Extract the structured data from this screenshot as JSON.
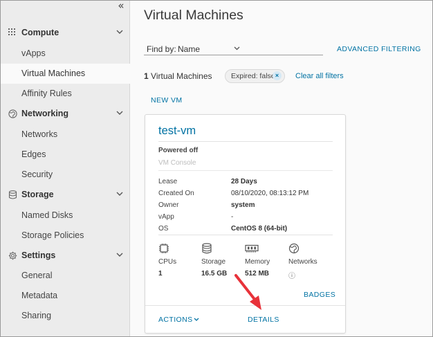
{
  "sidebar": {
    "collapse_glyph": "«",
    "groups": [
      {
        "label": "Compute",
        "icon": "grid-icon",
        "items": [
          "vApps",
          "Virtual Machines",
          "Affinity Rules"
        ]
      },
      {
        "label": "Networking",
        "icon": "globe-icon",
        "items": [
          "Networks",
          "Edges",
          "Security"
        ]
      },
      {
        "label": "Storage",
        "icon": "database-icon",
        "items": [
          "Named Disks",
          "Storage Policies"
        ]
      },
      {
        "label": "Settings",
        "icon": "gear-icon",
        "items": [
          "General",
          "Metadata",
          "Sharing"
        ]
      }
    ],
    "active_item": "Virtual Machines"
  },
  "main": {
    "title": "Virtual Machines",
    "find_by": {
      "label": "Find by:",
      "value": "Name"
    },
    "advanced_filtering": "ADVANCED FILTERING",
    "vm_count_number": "1",
    "vm_count_text": "Virtual Machines",
    "filter_chip": "Expired: false",
    "filter_chip_close": "×",
    "clear_all": "Clear all filters",
    "new_vm": "NEW VM"
  },
  "card": {
    "name": "test-vm",
    "power_state": "Powered off",
    "console": "VM Console",
    "properties": [
      {
        "key": "Lease",
        "value": "28 Days"
      },
      {
        "key": "Created On",
        "value": "08/10/2020, 08:13:12 PM"
      },
      {
        "key": "Owner",
        "value": "system"
      },
      {
        "key": "vApp",
        "value": "-"
      },
      {
        "key": "OS",
        "value": "CentOS 8 (64-bit)"
      }
    ],
    "resources": [
      {
        "label": "CPUs",
        "value": "1",
        "icon": "cpu-icon"
      },
      {
        "label": "Storage",
        "value": "16.5 GB",
        "icon": "database-icon"
      },
      {
        "label": "Memory",
        "value": "512 MB",
        "icon": "memory-icon"
      },
      {
        "label": "Networks",
        "value": "ⓘ",
        "icon": "globe-icon"
      }
    ],
    "badges": "BADGES",
    "actions": "ACTIONS",
    "details": "DETAILS"
  },
  "colors": {
    "accent": "#0072a3",
    "arrow": "#e8323a",
    "sidebar_bg": "#ececec"
  }
}
